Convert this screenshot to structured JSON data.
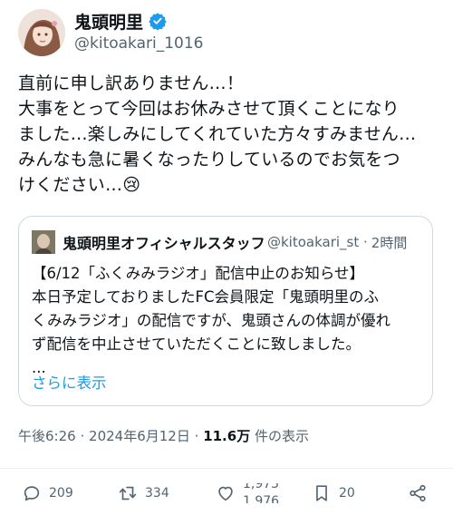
{
  "tweet": {
    "author_name": "鬼頭明里",
    "author_handle": "@kitoakari_1016",
    "lines": [
      "直前に申し訳ありません…！",
      "大事をとって今回はお休みさせて頂くことになり",
      "ました…楽しみにしてくれていた方々すみません…",
      "みんなも急に暑くなったりしているのでお気をつ",
      "けください…😢"
    ]
  },
  "quote": {
    "author_name": "鬼頭明里オフィシャルスタッフ",
    "author_handle": "@kitoakari_st",
    "time": "2時間",
    "lines": [
      "【6/12「ふくみみラジオ」配信中止のお知らせ】",
      "本日予定しておりましたFC会員限定「鬼頭明里のふ",
      "くみみラジオ」の配信ですが、鬼頭さんの体調が優れ",
      "ず配信を中止させていただくことに致しました。",
      "..."
    ],
    "show_more": "さらに表示"
  },
  "meta": {
    "time": "午後6:26",
    "sep1": "·",
    "date": "2024年6月12日",
    "sep2": "·",
    "views": "11.6万",
    "views_label": "件の表示"
  },
  "actions": {
    "replies": "209",
    "retweets": "334",
    "likes": "1,975",
    "likes_next": "1,976",
    "bookmarks": "20"
  },
  "colors": {
    "accent": "#1d9bf0",
    "verified": "#1d9bf0",
    "muted": "#536471",
    "text": "#0f1419"
  }
}
